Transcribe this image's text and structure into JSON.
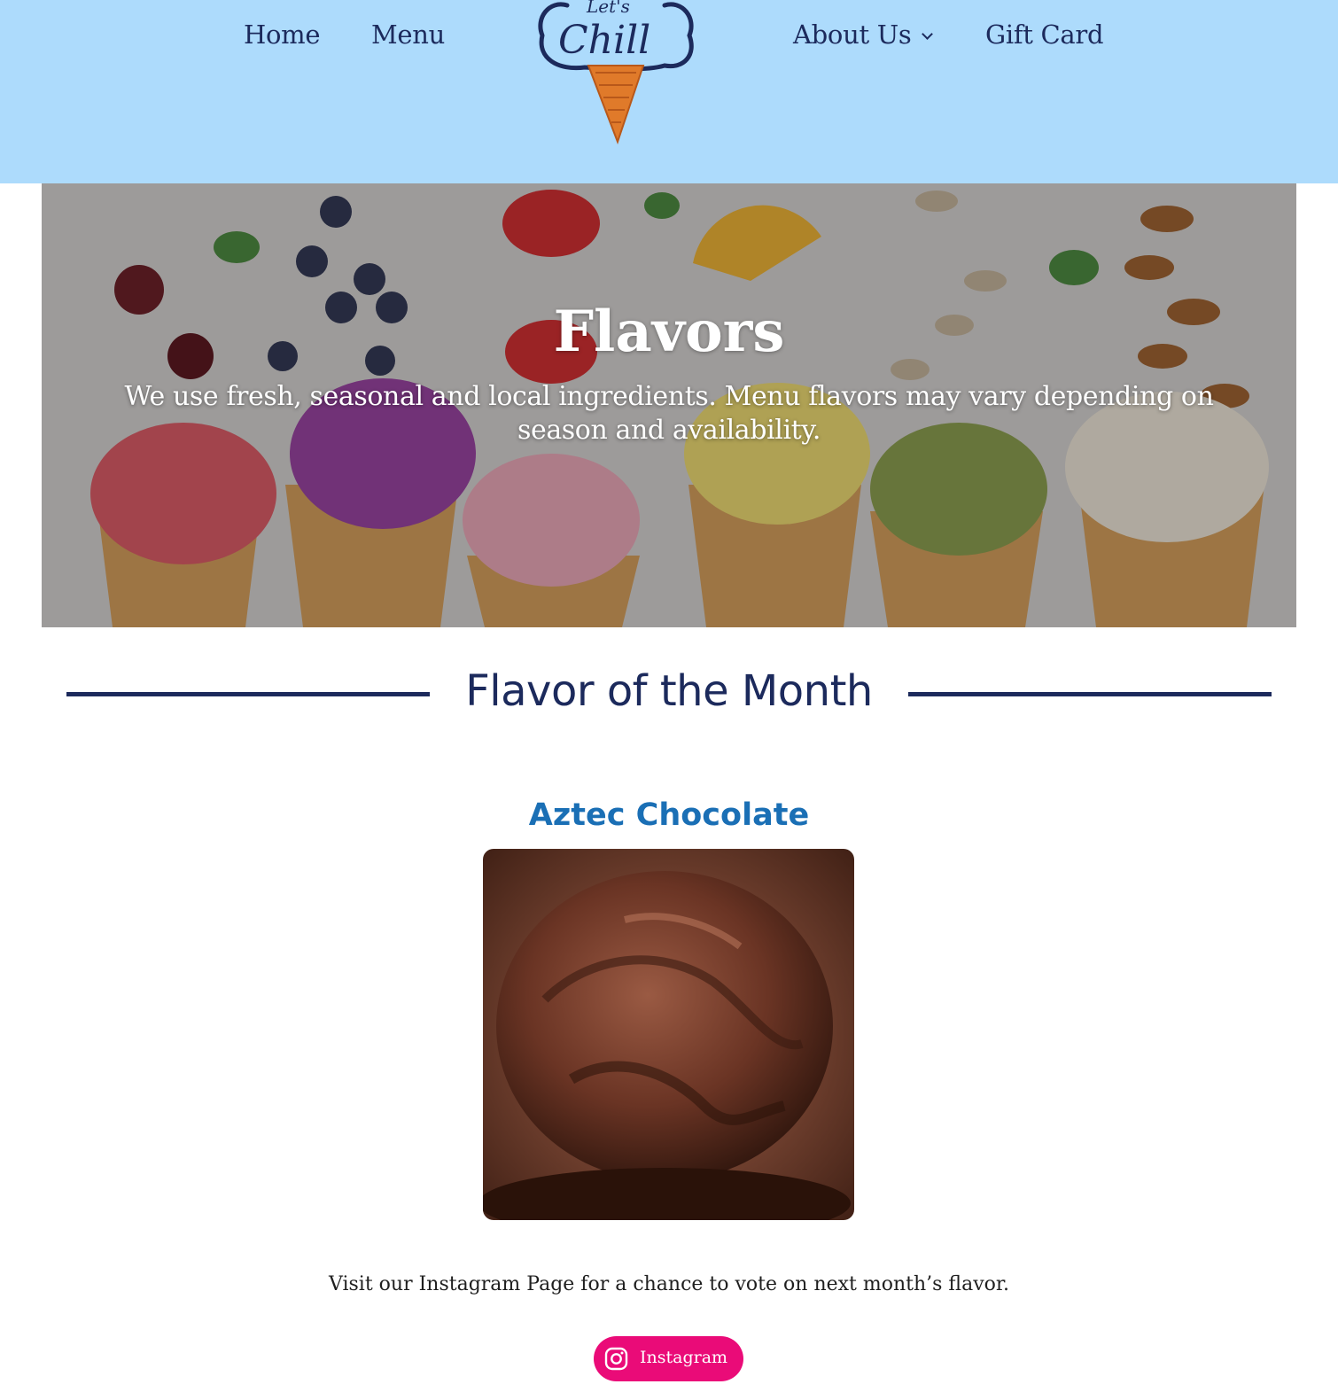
{
  "nav": {
    "home": "Home",
    "menu": "Menu",
    "about": "About Us",
    "gift_card": "Gift Card",
    "logo_text": "Let's Chill"
  },
  "hero": {
    "title": "Flavors",
    "subtitle": "We use fresh, seasonal and local ingredients. Menu flavors may vary depending on season and availability."
  },
  "flavor_of_month": {
    "heading": "Flavor of the Month",
    "name": "Aztec Chocolate",
    "vote_text": "Visit our Instagram Page for a chance to vote on next month’s flavor.",
    "button_label": "Instagram"
  },
  "colors": {
    "header_bg": "#addbfc",
    "navy": "#1c2a5c",
    "flavor_blue": "#1a6fb5",
    "instagram_pink": "#ea0b78"
  },
  "icons": {
    "chevron": "chevron-down-icon",
    "instagram": "instagram-icon"
  }
}
